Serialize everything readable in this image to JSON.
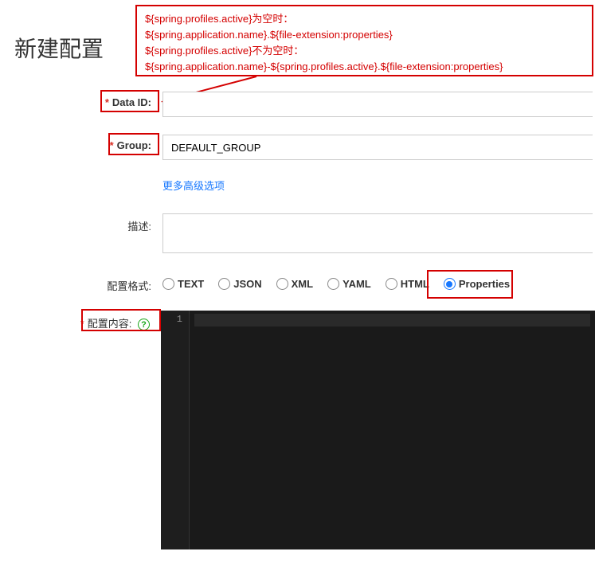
{
  "title": "新建配置",
  "annotation": {
    "line1": "${spring.profiles.active}为空时：",
    "line2": "${spring.application.name}.${file-extension:properties}",
    "line3": "${spring.profiles.active}不为空时：",
    "line4": "${spring.application.name}-${spring.profiles.active}.${file-extension:properties}"
  },
  "form": {
    "dataId": {
      "label": "Data ID:",
      "value": ""
    },
    "group": {
      "label": "Group:",
      "value": "DEFAULT_GROUP"
    },
    "moreOptions": "更多高级选项",
    "description": {
      "label": "描述:",
      "value": ""
    },
    "format": {
      "label": "配置格式:",
      "options": {
        "text": "TEXT",
        "json": "JSON",
        "xml": "XML",
        "yaml": "YAML",
        "html": "HTML",
        "properties": "Properties"
      },
      "selected": "properties"
    },
    "content": {
      "label": "配置内容:",
      "lineNumber": "1"
    }
  }
}
